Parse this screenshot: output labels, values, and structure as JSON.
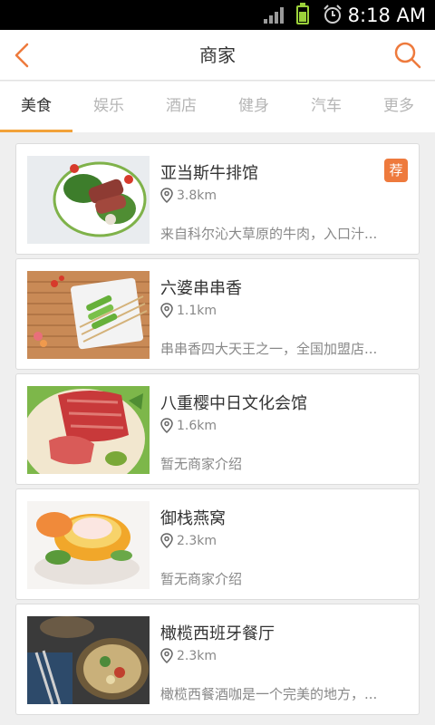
{
  "status_bar": {
    "time": "8:18 AM"
  },
  "header": {
    "title": "商家"
  },
  "tabs": [
    {
      "label": "美食"
    },
    {
      "label": "娱乐"
    },
    {
      "label": "酒店"
    },
    {
      "label": "健身"
    },
    {
      "label": "汽车"
    },
    {
      "label": "更多"
    }
  ],
  "active_tab": "美食",
  "merchants": [
    {
      "name": "亚当斯牛排馆",
      "distance": "3.8km",
      "description": "来自科尔沁大草原的牛肉，入口汁...",
      "badge": "荐"
    },
    {
      "name": "六婆串串香",
      "distance": "1.1km",
      "description": "串串香四大天王之一，全国加盟店..."
    },
    {
      "name": "八重樱中日文化会馆",
      "distance": "1.6km",
      "description": "暂无商家介绍"
    },
    {
      "name": "御栈燕窝",
      "distance": "2.3km",
      "description": "暂无商家介绍"
    },
    {
      "name": "橄榄西班牙餐厅",
      "distance": "2.3km",
      "description": "橄榄西餐酒咖是一个完美的地方，..."
    }
  ],
  "colors": {
    "accent": "#f2a23a",
    "icon": "#ee7a3d",
    "badge": "#ee7a3d"
  }
}
